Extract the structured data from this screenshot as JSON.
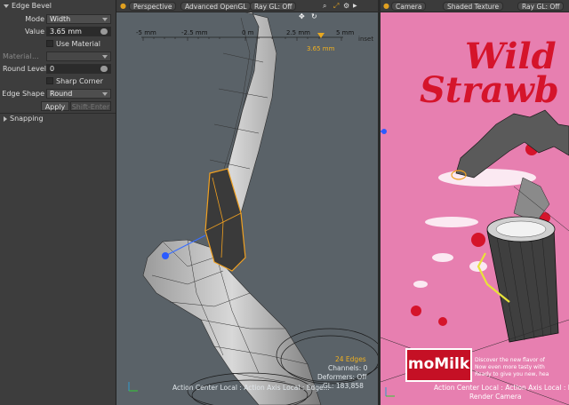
{
  "panel": {
    "section_title": "Edge Bevel",
    "mode": {
      "label": "Mode",
      "value": "Width"
    },
    "value": {
      "label": "Value",
      "value": "3.65 mm"
    },
    "use_material": {
      "label": "Use Material"
    },
    "material": {
      "label": "Material",
      "dots": "..."
    },
    "round_level": {
      "label": "Round Level",
      "value": "0"
    },
    "sharp_corner": {
      "label": "Sharp Corner"
    },
    "edge_shape": {
      "label": "Edge Shape",
      "value": "Round"
    },
    "apply_label": "Apply",
    "apply_hint": "Shift-Enter",
    "snapping_label": "Snapping"
  },
  "viewport_left": {
    "tabs": [
      "Perspective",
      "Advanced OpenGL",
      "Ray GL: Off"
    ],
    "ruler": {
      "ticks": [
        "-5 mm",
        "-2.5 mm",
        "0 m",
        "2.5 mm",
        "5 mm"
      ],
      "current": "3.65 mm",
      "suffix": "inset"
    },
    "status": {
      "edges": "24 Edges",
      "channels": "Channels: 0",
      "deformers": "Deformers: Off",
      "gl": "GL: 183,858",
      "action": "Action Center Local : Action Axis Local : Edge..."
    }
  },
  "viewport_right": {
    "tabs": [
      "Camera",
      "Shaded Texture",
      "Ray GL: Off"
    ],
    "ad": {
      "title_line1": "Wild",
      "title_line2": "Strawb",
      "logo": "moMilk",
      "lines": [
        "Discover the new flavor of",
        "Now even more tasty with",
        "Ready to give you new, hea"
      ]
    },
    "status": {
      "action": "Action Center Local : Action Axis Local : Ed",
      "camera": "Render Camera"
    }
  },
  "colors": {
    "selection": "#f0a020",
    "ad_background": "#e77fb0",
    "ad_red": "#d5142b"
  }
}
